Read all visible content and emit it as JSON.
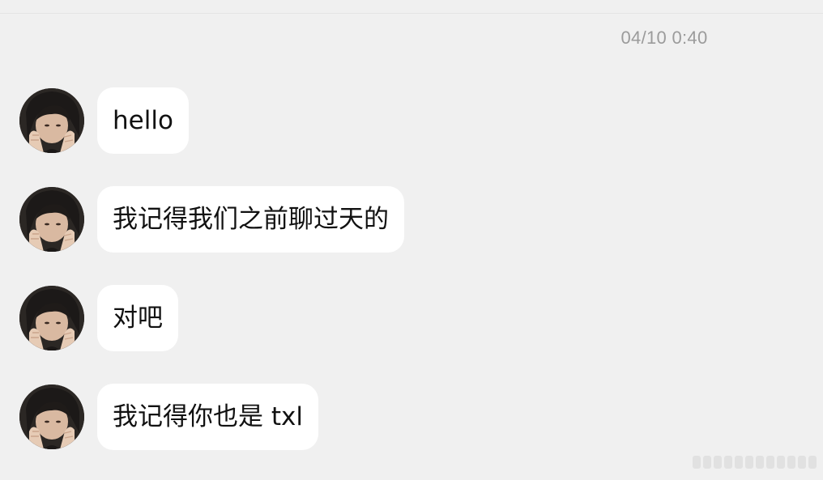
{
  "chat": {
    "timestamp": "04/10 0:40",
    "messages": [
      {
        "text": "hello"
      },
      {
        "text": "我记得我们之前聊过天的"
      },
      {
        "text": "对吧"
      },
      {
        "text": "我记得你也是 txl"
      }
    ]
  },
  "icons": {
    "avatar": "avatar-portrait-icon",
    "watermark": "watermark-logo"
  },
  "colors": {
    "background": "#f0f0f0",
    "bubble": "#ffffff",
    "timestamp_text": "#9b9b9b",
    "message_text": "#111111"
  }
}
